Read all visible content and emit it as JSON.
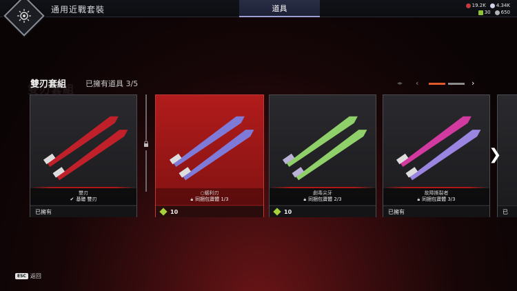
{
  "topbar": {
    "section_title": "通用近戰套裝",
    "active_tab": "道具",
    "currency": {
      "legend_tokens": "19.2K",
      "apex_coins": "4.34K",
      "crafting_metals": "30",
      "exotic_shards": "650"
    }
  },
  "collection": {
    "title": "雙刃套組",
    "title_ghost": "雙刃套組",
    "owned_label": "已擁有道具 3/5"
  },
  "pager": {
    "prev_icon": "chevron-left-icon",
    "next_icon": "chevron-right-icon",
    "active_color": "#e05a2a",
    "inactive_color": "#8c8c8c"
  },
  "cards": [
    {
      "name": "雙刃",
      "subtitle": "基礎 雙刃",
      "footer": "已擁有",
      "blade_color": "#c0202a"
    },
    {
      "name": "○鋸利刃",
      "subtitle": "同捆包寶體 1/3",
      "footer": "10",
      "blade_color": "#7f7ad8"
    },
    {
      "name": "劇毒尖牙",
      "subtitle": "同捆包寶體 2/3",
      "footer": "10",
      "blade_color": "#8fd06a"
    },
    {
      "name": "故障撕裂者",
      "subtitle": "同捆包寶體 3/3",
      "footer": "已擁有",
      "blade_color": "#d33aa0"
    }
  ],
  "peek_card": {
    "footer": "已"
  },
  "footer": {
    "esc_key": "ESC",
    "back_label": "返回"
  },
  "colors": {
    "selected_card": "#b21c1c",
    "gem": "#a6d23c"
  }
}
